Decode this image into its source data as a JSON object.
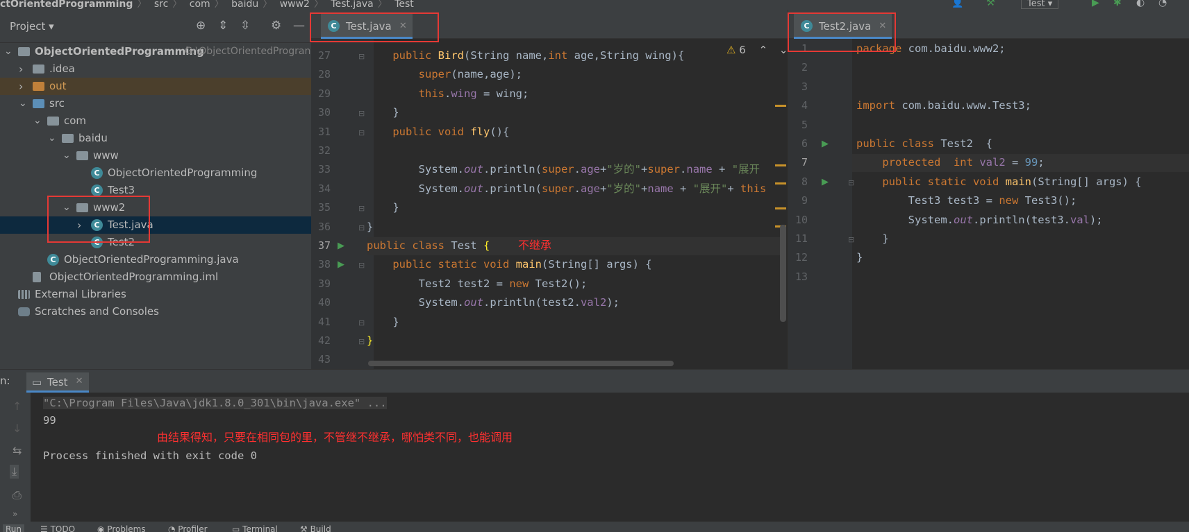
{
  "breadcrumb": {
    "items": [
      "ctOrientedProgramming",
      "src",
      "com",
      "baidu",
      "www2",
      "Test.java",
      "Test"
    ]
  },
  "toolbar": {
    "run_config": "Test"
  },
  "project_panel": {
    "title": "Project",
    "tree": [
      {
        "label": "ObjectOrientedProgramming",
        "suffix": "G:\\ObjectOrientedProgran",
        "depth": 0,
        "type": "module",
        "expanded": true
      },
      {
        "label": ".idea",
        "depth": 1,
        "type": "folder",
        "expanded": false
      },
      {
        "label": "out",
        "depth": 1,
        "type": "folder-out",
        "expanded": false
      },
      {
        "label": "src",
        "depth": 1,
        "type": "folder-src",
        "expanded": true
      },
      {
        "label": "com",
        "depth": 2,
        "type": "package",
        "expanded": true
      },
      {
        "label": "baidu",
        "depth": 3,
        "type": "package",
        "expanded": true
      },
      {
        "label": "www",
        "depth": 4,
        "type": "package",
        "expanded": true
      },
      {
        "label": "ObjectOrientedProgramming",
        "depth": 5,
        "type": "class"
      },
      {
        "label": "Test3",
        "depth": 5,
        "type": "class"
      },
      {
        "label": "www2",
        "depth": 4,
        "type": "package",
        "expanded": true
      },
      {
        "label": "Test.java",
        "depth": 5,
        "type": "class",
        "expanded": false,
        "selected": true
      },
      {
        "label": "Test2",
        "depth": 5,
        "type": "class"
      },
      {
        "label": "ObjectOrientedProgramming.java",
        "depth": 2,
        "type": "class"
      },
      {
        "label": "ObjectOrientedProgramming.iml",
        "depth": 1,
        "type": "file"
      },
      {
        "label": "External Libraries",
        "depth": 0,
        "type": "lib"
      },
      {
        "label": "Scratches and Consoles",
        "depth": 0,
        "type": "scratch"
      }
    ]
  },
  "editor_left": {
    "tab": "Test.java",
    "warnings": "6",
    "annotation": "不继承",
    "lines": [
      {
        "n": "27",
        "html": "    <span class='kw'>public</span> <span class='fn'>Bird</span>(String name,<span class='kw'>int</span> age,String wing){"
      },
      {
        "n": "28",
        "html": "        <span class='kw'>super</span>(name,age);"
      },
      {
        "n": "29",
        "html": "        <span class='kw'>this</span>.<span class='fld'>wing</span> = wing;"
      },
      {
        "n": "30",
        "html": "    }"
      },
      {
        "n": "31",
        "html": "    <span class='kw'>public void</span> <span class='fn'>fly</span>(){"
      },
      {
        "n": "32",
        "html": ""
      },
      {
        "n": "33",
        "html": "        System.<span class='st'>out</span>.println(<span class='kw'>super</span>.<span class='fld'>age</span>+<span class='str'>\"岁的\"</span>+<span class='kw'>super</span>.<span class='fld'>name</span> + <span class='str'>\"展开</span>"
      },
      {
        "n": "34",
        "html": "        System.<span class='st'>out</span>.println(<span class='kw'>super</span>.<span class='fld'>age</span>+<span class='str'>\"岁的\"</span>+<span class='fld'>name</span> + <span class='str'>\"展开\"</span>+ <span class='kw'>this</span>"
      },
      {
        "n": "35",
        "html": "    }"
      },
      {
        "n": "36",
        "html": "}"
      },
      {
        "n": "37",
        "html": "<span class='kw'>public class</span> Test <span class='brace'>{</span>"
      },
      {
        "n": "38",
        "html": "    <span class='kw'>public static void</span> <span class='fn'>main</span>(String[] args) {"
      },
      {
        "n": "39",
        "html": "        Test2 test2 = <span class='kw'>new</span> Test2();"
      },
      {
        "n": "40",
        "html": "        System.<span class='st'>out</span>.println(test2.<span class='fld'>val2</span>);"
      },
      {
        "n": "41",
        "html": "    }"
      },
      {
        "n": "42",
        "html": "<span class='brace'>}</span>"
      },
      {
        "n": "43",
        "html": ""
      }
    ]
  },
  "editor_right": {
    "tab": "Test2.java",
    "lines": [
      {
        "n": "1",
        "html": "<span class='kw'>package</span> com.baidu.www2;"
      },
      {
        "n": "2",
        "html": ""
      },
      {
        "n": "3",
        "html": ""
      },
      {
        "n": "4",
        "html": "<span class='kw'>import</span> com.baidu.www.Test3;"
      },
      {
        "n": "5",
        "html": ""
      },
      {
        "n": "6",
        "html": "<span class='kw'>public class</span> Test2  {"
      },
      {
        "n": "7",
        "html": "    <span class='kw'>protected  int</span> <span class='fld'>val2</span> = <span class='num'>99</span>;"
      },
      {
        "n": "8",
        "html": "    <span class='kw'>public static void</span> <span class='fn'>main</span>(String[] args) {"
      },
      {
        "n": "9",
        "html": "        Test3 test3 = <span class='kw'>new</span> Test3();"
      },
      {
        "n": "10",
        "html": "        System.<span class='st'>out</span>.println(test3.<span class='fld'>val</span>);"
      },
      {
        "n": "11",
        "html": "    }"
      },
      {
        "n": "12",
        "html": "}"
      },
      {
        "n": "13",
        "html": ""
      }
    ]
  },
  "run_panel": {
    "label": "n:",
    "tab": "Test",
    "command": "\"C:\\Program Files\\Java\\jdk1.8.0_301\\bin\\java.exe\" ...",
    "output": "99",
    "exit": "Process finished with exit code 0",
    "annotation": "由结果得知，只要在相同包的里，不管继不继承，哪怕类不同，也能调用"
  },
  "bottom_bar": {
    "items": [
      "Run",
      "TODO",
      "Problems",
      "Profiler",
      "Terminal",
      "Build"
    ]
  },
  "colors": {
    "highlight_box": "#e53935",
    "annotation_text": "#ff3030",
    "keyword": "#cc7832",
    "string": "#6a8759"
  }
}
